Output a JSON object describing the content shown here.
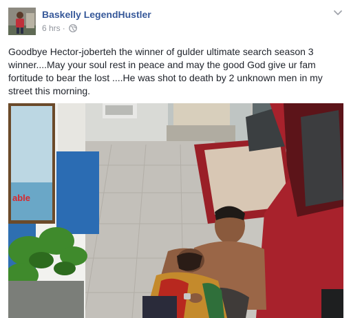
{
  "post": {
    "author": "Baskelly LegendHustler",
    "time": "6 hrs",
    "separator": "·",
    "privacy_icon": "globe-icon",
    "menu_icon": "chevron-down-icon",
    "text": "Goodbye Hector-joberteh the winner of gulder ultimate search season 3 winner....May your soul rest in peace and may the good God give ur fam fortitude to bear the lost ....He was shot to death by 2 unknown men in my street this morning.",
    "sign_text": "able"
  },
  "colors": {
    "author_link": "#365899",
    "meta_text": "#90949c",
    "body_text": "#1d2129",
    "car_red": "#a8222c"
  }
}
